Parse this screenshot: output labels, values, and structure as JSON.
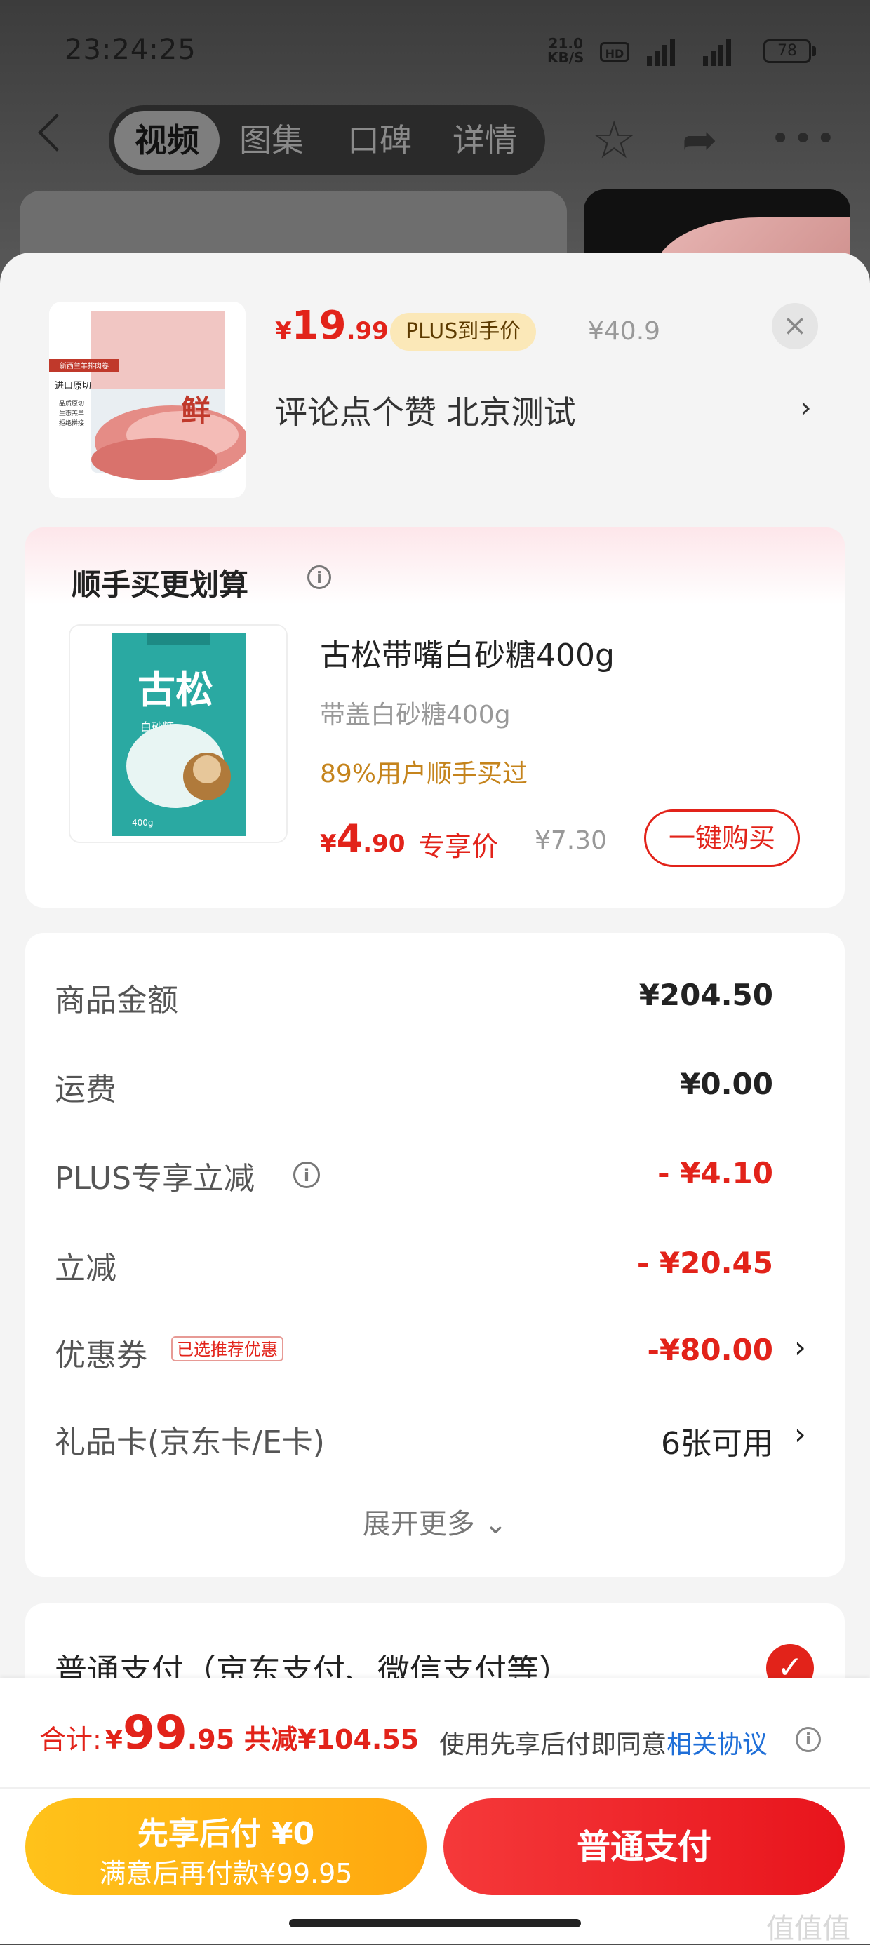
{
  "status_bar": {
    "time": "23:24:25",
    "net_speed": "21.0",
    "net_unit": "KB/S",
    "hd": "HD",
    "net1": "5G",
    "net2": "5G",
    "battery": "78"
  },
  "nav": {
    "tabs": [
      "视频",
      "图集",
      "口碑",
      "详情"
    ],
    "active_tab": 0
  },
  "product": {
    "price_currency": "¥",
    "price_int": "19",
    "price_dec": ".99",
    "plus_badge": "PLUS到手价",
    "original_price": "¥40.9",
    "spec": "评论点个赞  北京测试",
    "img_text": [
      "新西兰羊排肉卷",
      "进口原切",
      "品质原切",
      "生态羔羊",
      "拒绝拼接",
      "鲜"
    ]
  },
  "addon": {
    "title": "顺手买更划算",
    "name": "古松带嘴白砂糖400g",
    "subtitle": "带盖白砂糖400g",
    "percent_text": "89%用户顺手买过",
    "price_currency": "¥",
    "price_int": "4",
    "price_dec": ".90",
    "exclusive_label": "专享价",
    "original_price": "¥7.30",
    "buy_button": "一键购买",
    "img_text": [
      "古松",
      "白砂糖",
      "400g"
    ]
  },
  "summary": {
    "rows": [
      {
        "label": "商品金额",
        "value": "¥204.50"
      },
      {
        "label": "运费",
        "value": "¥0.00"
      },
      {
        "label": "PLUS专享立减",
        "value": "- ¥4.10"
      },
      {
        "label": "立减",
        "value": "- ¥20.45"
      },
      {
        "label": "优惠券",
        "value": "-¥80.00",
        "tag": "已选推荐优惠"
      },
      {
        "label": "礼品卡(京东卡/E卡)",
        "value": "6张可用"
      }
    ],
    "expand": "展开更多"
  },
  "payment": {
    "option": "普通支付（京东支付、微信支付等）"
  },
  "bottom": {
    "total_label": "合计:",
    "total_currency": "¥",
    "total_int": "99",
    "total_dec": ".95",
    "total_saved": "共减¥104.55",
    "agreement_prefix": "使用先享后付即同意",
    "agreement_link": "相关协议",
    "btn_later_title": "先享后付 ¥0",
    "btn_later_sub": "满意后再付款¥99.95",
    "btn_pay": "普通支付"
  },
  "watermark": "值 什么值得买",
  "colors": {
    "accent_red": "#e2231a",
    "plus_gold": "#fbe8b8",
    "later_yellow": "#ffb315",
    "link_blue": "#1f6fd8"
  }
}
